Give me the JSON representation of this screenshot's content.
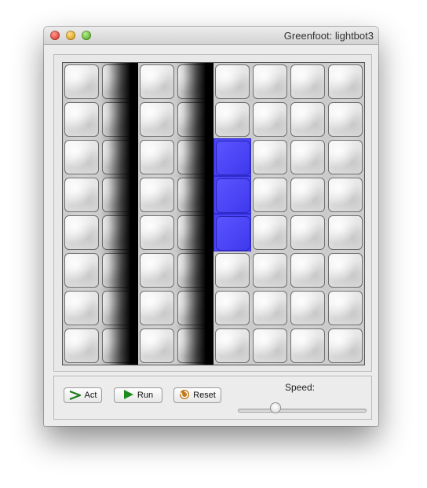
{
  "window": {
    "title": "Greenfoot: lightbot3"
  },
  "world": {
    "columns": 8,
    "rows": 8,
    "wall_columns": [
      1,
      3
    ],
    "lit_cells": [
      {
        "col": 4,
        "row": 2
      },
      {
        "col": 4,
        "row": 3
      },
      {
        "col": 4,
        "row": 4
      }
    ],
    "colors": {
      "lit": "#4a44f5",
      "wall": "#000000"
    }
  },
  "controls": {
    "act_label": "Act",
    "run_label": "Run",
    "reset_label": "Reset",
    "speed_label": "Speed:",
    "speed_value": 0.27,
    "icons": {
      "act": "step-arrow-icon",
      "run": "play-icon",
      "reset": "reset-icon"
    }
  }
}
